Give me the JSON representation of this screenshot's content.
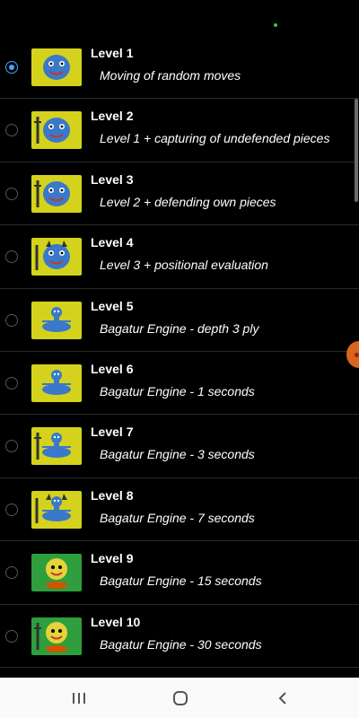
{
  "levels": [
    {
      "title": "Level 1",
      "desc": "Moving of random moves",
      "selected": true,
      "avatar": "blue-face-icon"
    },
    {
      "title": "Level 2",
      "desc": "Level 1 + capturing of undefended pieces",
      "selected": false,
      "avatar": "blue-face-sword-icon"
    },
    {
      "title": "Level 3",
      "desc": "Level 2 + defending own pieces",
      "selected": false,
      "avatar": "blue-face-sword-icon"
    },
    {
      "title": "Level 4",
      "desc": "Level 3 + positional evaluation",
      "selected": false,
      "avatar": "blue-face-horns-icon"
    },
    {
      "title": "Level 5",
      "desc": "Bagatur Engine - depth 3 ply",
      "selected": false,
      "avatar": "blue-robot-icon"
    },
    {
      "title": "Level 6",
      "desc": "Bagatur Engine - 1 seconds",
      "selected": false,
      "avatar": "blue-robot-icon"
    },
    {
      "title": "Level 7",
      "desc": "Bagatur Engine - 3 seconds",
      "selected": false,
      "avatar": "blue-robot-sword-icon"
    },
    {
      "title": "Level 8",
      "desc": "Bagatur Engine - 7 seconds",
      "selected": false,
      "avatar": "blue-robot-horns-icon"
    },
    {
      "title": "Level 9",
      "desc": "Bagatur Engine - 15 seconds",
      "selected": false,
      "avatar": "yellow-face-icon"
    },
    {
      "title": "Level 10",
      "desc": "Bagatur Engine - 30 seconds",
      "selected": false,
      "avatar": "yellow-face-sword-icon"
    }
  ],
  "colors": {
    "accent": "#4aa3ff",
    "background": "#000000",
    "avatar_yellow": "#d4d21c",
    "avatar_blue": "#3a78c9",
    "avatar_green": "#2f9e3e"
  },
  "navbar": {
    "recent_icon": "recent-apps-icon",
    "home_icon": "home-icon",
    "back_icon": "back-icon"
  }
}
